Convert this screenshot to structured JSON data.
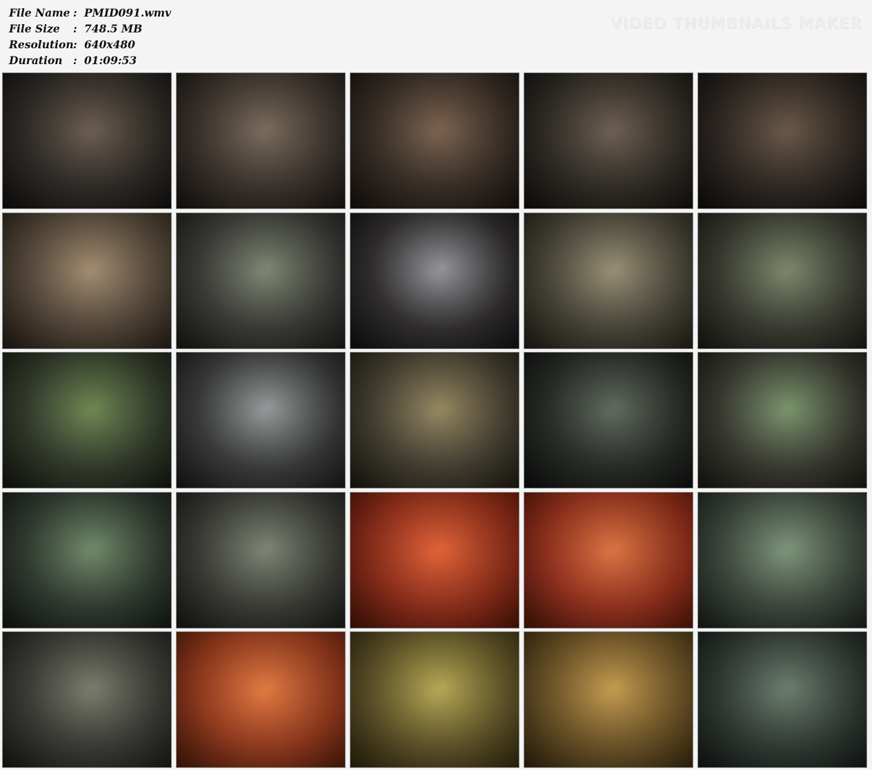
{
  "file_info": {
    "file_name_label": "File Name",
    "file_name_value": "PMID091.wmv",
    "file_size_label": "File Size",
    "file_size_value": "748.5 MB",
    "resolution_label": "Resolution",
    "resolution_value": "640x480",
    "duration_label": "Duration",
    "duration_value": "01:09:53",
    "separator": ":"
  },
  "watermark": "VIDEO THUMBNAILS MAKER",
  "thumbnails": [
    {
      "colors": [
        "#2a2520",
        "#5a4a3a",
        "#14110e"
      ]
    },
    {
      "colors": [
        "#3a3028",
        "#6a5a48",
        "#1b1713"
      ]
    },
    {
      "colors": [
        "#35291f",
        "#6e5038",
        "#1a140f"
      ]
    },
    {
      "colors": [
        "#2d2720",
        "#5c4c3c",
        "#15120e"
      ]
    },
    {
      "colors": [
        "#2a221c",
        "#57432f",
        "#120f0c"
      ]
    },
    {
      "colors": [
        "#5a4a38",
        "#9a8060",
        "#2a2118"
      ]
    },
    {
      "colors": [
        "#3a3a36",
        "#6f7a62",
        "#1e1f1a"
      ]
    },
    {
      "colors": [
        "#2d2a2a",
        "#8a8a90",
        "#141214"
      ]
    },
    {
      "colors": [
        "#4d4838",
        "#8c8464",
        "#26231a"
      ]
    },
    {
      "colors": [
        "#3a3d30",
        "#6e7a58",
        "#1c1e16"
      ]
    },
    {
      "colors": [
        "#2f3a26",
        "#5e7a3e",
        "#151a10"
      ]
    },
    {
      "colors": [
        "#3a3c3a",
        "#8a9090",
        "#1b1c1b"
      ]
    },
    {
      "colors": [
        "#46402e",
        "#8a7a4e",
        "#211d14"
      ]
    },
    {
      "colors": [
        "#222622",
        "#4d5a4a",
        "#101210"
      ]
    },
    {
      "colors": [
        "#3a3a30",
        "#6a8a5a",
        "#1c1c16"
      ]
    },
    {
      "colors": [
        "#2e3a2e",
        "#5e7e56",
        "#151c15"
      ]
    },
    {
      "colors": [
        "#3a3c34",
        "#6e7866",
        "#1c1d18"
      ]
    },
    {
      "colors": [
        "#a82a10",
        "#e0501e",
        "#5a1508"
      ]
    },
    {
      "colors": [
        "#b02e14",
        "#d8642a",
        "#5e180a"
      ]
    },
    {
      "colors": [
        "#3e4a3e",
        "#6e8a6a",
        "#1d241d"
      ]
    },
    {
      "colors": [
        "#3a3a34",
        "#6a6e5a",
        "#1c1c18"
      ]
    },
    {
      "colors": [
        "#b03a14",
        "#e06a2a",
        "#5a1e0a"
      ]
    },
    {
      "colors": [
        "#6a5a22",
        "#b0a040",
        "#352c10"
      ]
    },
    {
      "colors": [
        "#7a5a20",
        "#c0903a",
        "#3c2c10"
      ]
    },
    {
      "colors": [
        "#2e3a32",
        "#5a6e5e",
        "#151c18"
      ]
    }
  ]
}
